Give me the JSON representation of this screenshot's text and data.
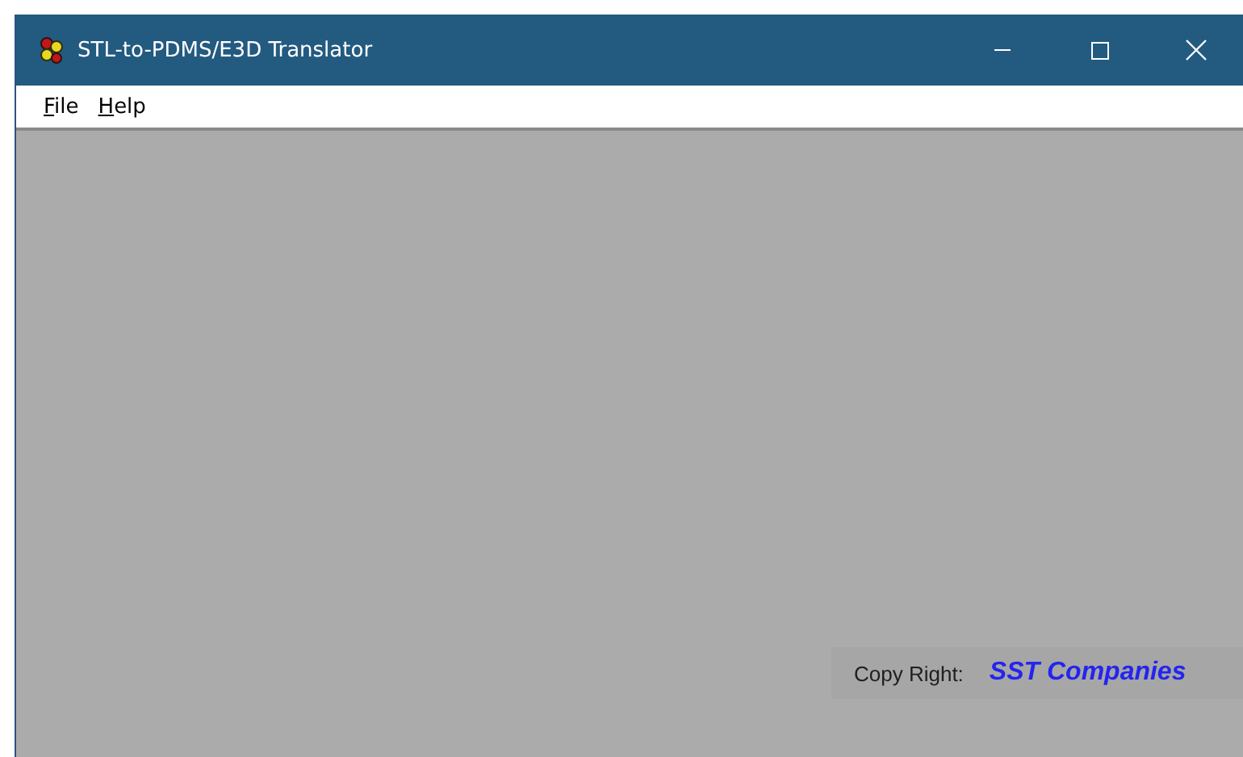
{
  "window": {
    "title": "STL-to-PDMS/E3D Translator"
  },
  "menu": [
    {
      "label": "File",
      "mnemonic_underlined": true
    },
    {
      "label": "Help",
      "mnemonic_underlined": true
    }
  ],
  "footer": {
    "label": "Copy Right:",
    "company": "SST Companies"
  }
}
